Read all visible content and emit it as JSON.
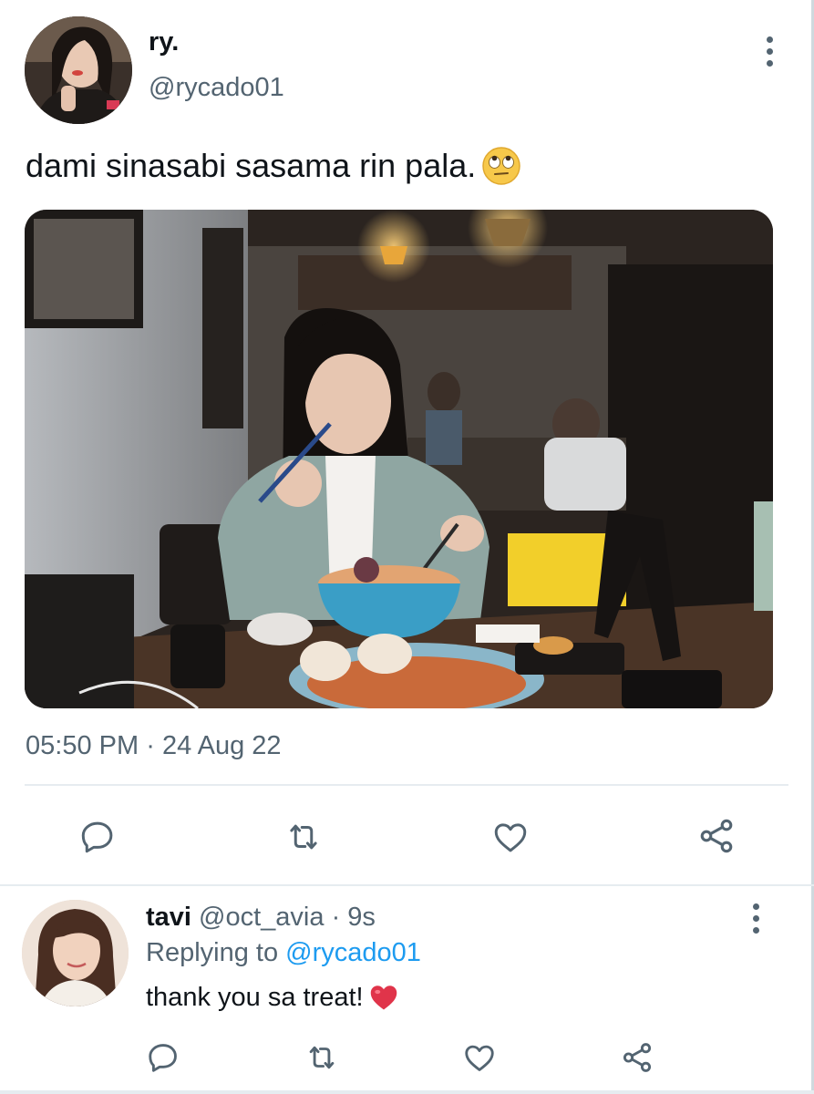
{
  "main_tweet": {
    "author_name": "ry.",
    "author_handle": "@rycado01",
    "text": "dami sinasabi sasama rin pala.",
    "text_emoji": "face-with-rolling-eyes",
    "media": "photo of a woman eating seafood in a restaurant",
    "time": "05:50 PM",
    "separator": "·",
    "date": "24 Aug 22",
    "more_icon": "more-vertical-icon",
    "actions": {
      "reply_icon": "reply-icon",
      "retweet_icon": "retweet-icon",
      "like_icon": "heart-icon",
      "share_icon": "share-icon"
    }
  },
  "reply": {
    "author_name": "tavi",
    "author_handle": "@oct_avia",
    "separator": "·",
    "age": "9s",
    "replying_to_label": "Replying to",
    "replying_to_handle": "@rycado01",
    "text": "thank you sa treat!",
    "text_emoji": "red-heart",
    "more_icon": "more-vertical-icon"
  },
  "colors": {
    "primary_text": "#0f1419",
    "secondary_text": "#536471",
    "accent": "#1d9bf0",
    "divider": "#e6ecf0",
    "heart_emoji": "#e0344a"
  }
}
